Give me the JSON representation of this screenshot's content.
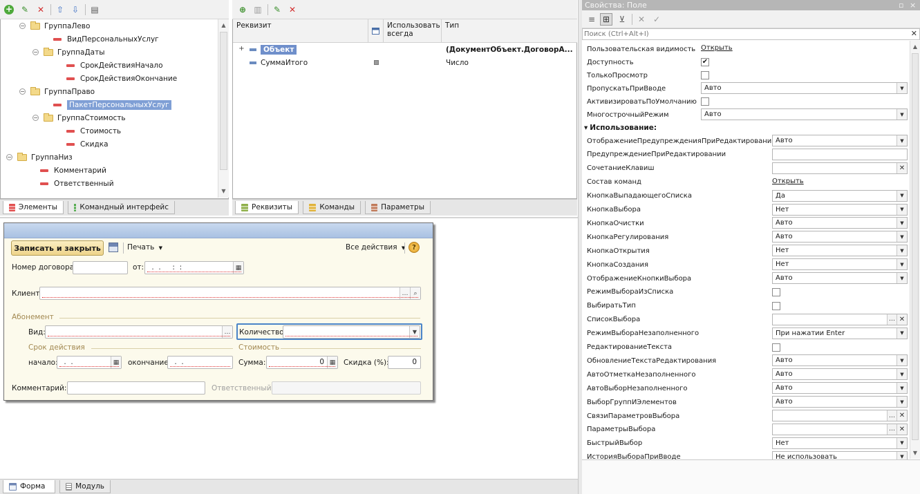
{
  "elements_tree": {
    "items": [
      {
        "label": "ГруппаЛево",
        "kind": "group",
        "expander": "−"
      },
      {
        "label": "ВидПерсональныхУслуг",
        "kind": "field"
      },
      {
        "label": "ГруппаДаты",
        "kind": "group",
        "expander": "−"
      },
      {
        "label": "СрокДействияНачало",
        "kind": "field"
      },
      {
        "label": "СрокДействияОкончание",
        "kind": "field"
      },
      {
        "label": "ГруппаПраво",
        "kind": "group",
        "expander": "−"
      },
      {
        "label": "ПакетПерсональныхУслуг",
        "kind": "field",
        "selected": true
      },
      {
        "label": "ГруппаСтоимость",
        "kind": "group",
        "expander": "−"
      },
      {
        "label": "Стоимость",
        "kind": "field"
      },
      {
        "label": "Скидка",
        "kind": "field"
      },
      {
        "label": "ГруппаНиз",
        "kind": "group",
        "expander": "−"
      },
      {
        "label": "Комментарий",
        "kind": "field"
      },
      {
        "label": "Ответственный",
        "kind": "field"
      }
    ],
    "tabs": [
      "Элементы",
      "Командный интерфейс"
    ]
  },
  "attributes": {
    "headers": {
      "attr": "Реквизит",
      "use_always": "Использовать всегда",
      "type": "Тип"
    },
    "rows": [
      {
        "name": "Объект",
        "type": "(ДокументОбъект.ДоговорА...",
        "expander": "+"
      },
      {
        "name": "СуммаИтого",
        "type": "Число"
      }
    ],
    "tabs": [
      "Реквизиты",
      "Команды",
      "Параметры"
    ]
  },
  "form": {
    "save_close": "Записать и закрыть",
    "print": "Печать",
    "all_actions": "Все действия",
    "help": "?",
    "contract_no_label": "Номер договора:",
    "from_label": "от:",
    "date_mask": " .  .     :  :",
    "client_label": "Клиент:",
    "group_abonement": "Абонемент",
    "kind_label": "Вид:",
    "quantity_label": "Количество:",
    "group_validity": "Срок действия",
    "group_cost": "Стоимость",
    "start_label": "начало:",
    "end_label": "окончание:",
    "short_date_mask": " .  .",
    "sum_label": "Сумма:",
    "sum_value": "0",
    "discount_label": "Скидка (%):",
    "discount_value": "0",
    "comment_label": "Комментарий:",
    "responsible_label": "Ответственный:"
  },
  "bottom_tabs": [
    "Форма",
    "Модуль"
  ],
  "properties": {
    "title": "Свойства: Поле",
    "pin": "▫",
    "close": "×",
    "search_placeholder": "Поиск (Ctrl+Alt+I)",
    "section_use": "Использование:",
    "top_rows": [
      {
        "name": "Пользовательская видимость",
        "kind": "link",
        "value": "Открыть"
      },
      {
        "name": "Доступность",
        "kind": "check",
        "checked": "✔"
      },
      {
        "name": "ТолькоПросмотр",
        "kind": "check",
        "checked": ""
      },
      {
        "name": "ПропускатьПриВводе",
        "kind": "select",
        "value": "Авто"
      },
      {
        "name": "АктивизироватьПоУмолчанию",
        "kind": "check",
        "checked": ""
      },
      {
        "name": "МногострочныйРежим",
        "kind": "select",
        "value": "Авто"
      }
    ],
    "use_rows": [
      {
        "name": "ОтображениеПредупрежденияПриРедактировании",
        "kind": "select",
        "value": "Авто"
      },
      {
        "name": "ПредупреждениеПриРедактировании",
        "kind": "text",
        "value": ""
      },
      {
        "name": "СочетаниеКлавиш",
        "kind": "clear",
        "value": ""
      },
      {
        "name": "Состав команд",
        "kind": "link",
        "value": "Открыть"
      },
      {
        "name": "КнопкаВыпадающегоСписка",
        "kind": "select",
        "value": "Да"
      },
      {
        "name": "КнопкаВыбора",
        "kind": "select",
        "value": "Нет"
      },
      {
        "name": "КнопкаОчистки",
        "kind": "select",
        "value": "Авто"
      },
      {
        "name": "КнопкаРегулирования",
        "kind": "select",
        "value": "Авто"
      },
      {
        "name": "КнопкаОткрытия",
        "kind": "select",
        "value": "Нет"
      },
      {
        "name": "КнопкаСоздания",
        "kind": "select",
        "value": "Нет"
      },
      {
        "name": "ОтображениеКнопкиВыбора",
        "kind": "select",
        "value": "Авто"
      },
      {
        "name": "РежимВыбораИзСписка",
        "kind": "check",
        "checked": ""
      },
      {
        "name": "ВыбиратьТип",
        "kind": "check",
        "checked": ""
      },
      {
        "name": "СписокВыбора",
        "kind": "ellipclear",
        "value": ""
      },
      {
        "name": "РежимВыбораНезаполненного",
        "kind": "select",
        "value": "При нажатии Enter"
      },
      {
        "name": "РедактированиеТекста",
        "kind": "check",
        "checked": ""
      },
      {
        "name": "ОбновлениеТекстаРедактирования",
        "kind": "select",
        "value": "Авто"
      },
      {
        "name": "АвтоОтметкаНезаполненного",
        "kind": "select",
        "value": "Авто"
      },
      {
        "name": "АвтоВыборНезаполненного",
        "kind": "select",
        "value": "Авто"
      },
      {
        "name": "ВыборГруппИЭлементов",
        "kind": "select",
        "value": "Авто"
      },
      {
        "name": "СвязиПараметровВыбора",
        "kind": "ellipclear",
        "value": ""
      },
      {
        "name": "ПараметрыВыбора",
        "kind": "ellipclear",
        "value": ""
      },
      {
        "name": "БыстрыйВыбор",
        "kind": "select",
        "value": "Нет"
      },
      {
        "name": "ИсторияВыбораПриВводе",
        "kind": "select",
        "value": "Не использовать"
      }
    ]
  }
}
